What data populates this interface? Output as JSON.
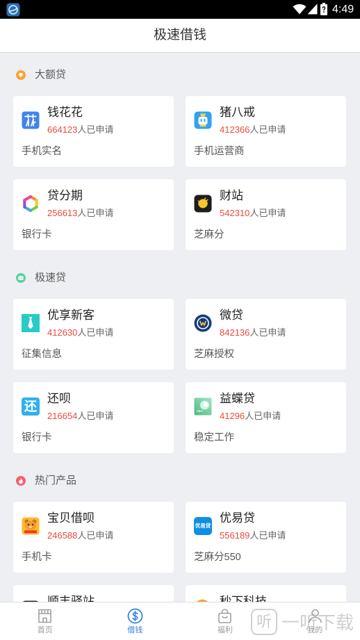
{
  "status_bar": {
    "time": "4:49",
    "app_icon": "app-notification-icon",
    "icons": [
      "wifi-icon",
      "signal-icon",
      "battery-icon"
    ]
  },
  "header": {
    "title": "极速借钱"
  },
  "labels": {
    "applied_suffix": "人已申请"
  },
  "colors": {
    "accent": "#2f80e2",
    "applicant_count": "#ea4a3d",
    "background": "#edeff2",
    "card": "#ffffff"
  },
  "sections": [
    {
      "title": "大额贷",
      "icon": "diamond-icon",
      "icon_color": "#f7a53a",
      "products": [
        {
          "name": "钱花花",
          "applicants": "664123",
          "requirement": "手机实名",
          "icon": "qianhuahua-logo-icon"
        },
        {
          "name": "猪八戒",
          "applicants": "412366",
          "requirement": "手机运营商",
          "icon": "zhubajie-logo-icon"
        },
        {
          "name": "贷分期",
          "applicants": "256613",
          "requirement": "银行卡",
          "icon": "daifenqi-logo-icon"
        },
        {
          "name": "财站",
          "applicants": "542310",
          "requirement": "芝麻分",
          "icon": "caizhan-logo-icon"
        }
      ]
    },
    {
      "title": "极速贷",
      "icon": "robot-icon",
      "icon_color": "#5fd0a4",
      "products": [
        {
          "name": "优享新客",
          "applicants": "412630",
          "requirement": "征集信息",
          "icon": "youxiangxinke-logo-icon"
        },
        {
          "name": "微贷",
          "applicants": "842136",
          "requirement": "芝麻授权",
          "icon": "weidai-logo-icon"
        },
        {
          "name": "还呗",
          "applicants": "216654",
          "requirement": "银行卡",
          "icon": "huanbei-logo-icon",
          "logo_text": "还"
        },
        {
          "name": "益蝶贷",
          "applicants": "41296",
          "requirement": "稳定工作",
          "icon": "yidiedai-logo-icon"
        }
      ]
    },
    {
      "title": "热门产品",
      "icon": "flame-icon",
      "icon_color": "#f4606d",
      "products": [
        {
          "name": "宝贝借呗",
          "applicants": "246588",
          "requirement": "手机卡",
          "icon": "baobeijiebei-logo-icon"
        },
        {
          "name": "优易贷",
          "applicants": "556189",
          "requirement": "芝麻分550",
          "icon": "youyidai-logo-icon",
          "logo_text": "优易贷"
        },
        {
          "name": "顺丰驿站",
          "icon": "shunfengyizhan-logo-icon"
        },
        {
          "name": "秒下科技",
          "icon": "miaoxiakeji-logo-icon"
        }
      ]
    }
  ],
  "bottom_nav": [
    {
      "label": "首页",
      "icon": "storefront-icon",
      "active": false
    },
    {
      "label": "借钱",
      "icon": "dollar-circle-icon",
      "active": true
    },
    {
      "label": "福利",
      "icon": "gift-bag-icon",
      "active": false
    },
    {
      "label": "我的",
      "icon": "person-icon",
      "active": false
    }
  ],
  "watermark": {
    "logo_text": "听",
    "text": "一听下载"
  }
}
